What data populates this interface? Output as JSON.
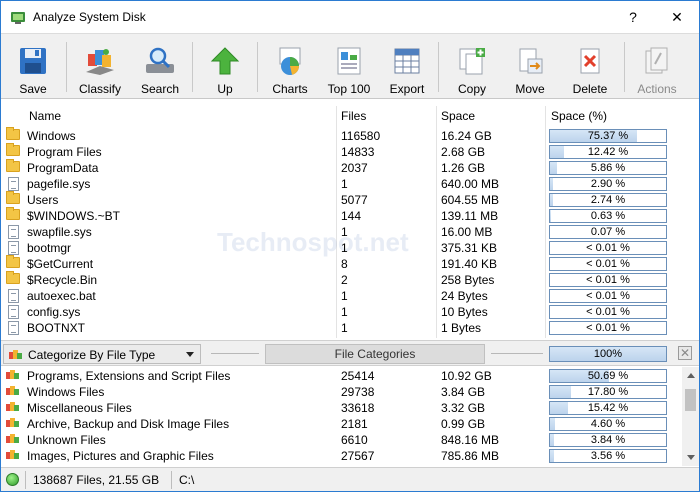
{
  "window": {
    "title": "Analyze System Disk",
    "help_label": "?",
    "close_label": "✕"
  },
  "toolbar": [
    {
      "id": "save",
      "label": "Save",
      "icon": "floppy-disk-icon"
    },
    {
      "id": "classify",
      "label": "Classify",
      "icon": "classify-icon"
    },
    {
      "id": "search",
      "label": "Search",
      "icon": "magnifier-icon"
    },
    {
      "id": "up",
      "label": "Up",
      "icon": "up-arrow-icon"
    },
    {
      "id": "charts",
      "label": "Charts",
      "icon": "pie-chart-icon"
    },
    {
      "id": "top100",
      "label": "Top 100",
      "icon": "top100-icon"
    },
    {
      "id": "export",
      "label": "Export",
      "icon": "export-icon"
    },
    {
      "id": "copy",
      "label": "Copy",
      "icon": "copy-icon"
    },
    {
      "id": "move",
      "label": "Move",
      "icon": "move-icon"
    },
    {
      "id": "delete",
      "label": "Delete",
      "icon": "delete-icon"
    },
    {
      "id": "actions",
      "label": "Actions",
      "icon": "actions-icon",
      "disabled": true
    }
  ],
  "columns": {
    "name": "Name",
    "files": "Files",
    "space": "Space",
    "space_pct": "Space (%)"
  },
  "rows": [
    {
      "name": "Windows",
      "files": "116580",
      "space": "16.24 GB",
      "pct_label": "75.37 %",
      "pct": 75.37,
      "type": "folder"
    },
    {
      "name": "Program Files",
      "files": "14833",
      "space": "2.68 GB",
      "pct_label": "12.42 %",
      "pct": 12.42,
      "type": "folder"
    },
    {
      "name": "ProgramData",
      "files": "2037",
      "space": "1.26 GB",
      "pct_label": "5.86 %",
      "pct": 5.86,
      "type": "folder"
    },
    {
      "name": "pagefile.sys",
      "files": "1",
      "space": "640.00 MB",
      "pct_label": "2.90 %",
      "pct": 2.9,
      "type": "file"
    },
    {
      "name": "Users",
      "files": "5077",
      "space": "604.55 MB",
      "pct_label": "2.74 %",
      "pct": 2.74,
      "type": "folder"
    },
    {
      "name": "$WINDOWS.~BT",
      "files": "144",
      "space": "139.11 MB",
      "pct_label": "0.63 %",
      "pct": 0.63,
      "type": "folder"
    },
    {
      "name": "swapfile.sys",
      "files": "1",
      "space": "16.00 MB",
      "pct_label": "0.07 %",
      "pct": 0.07,
      "type": "file"
    },
    {
      "name": "bootmgr",
      "files": "1",
      "space": "375.31 KB",
      "pct_label": "< 0.01 %",
      "pct": 0,
      "type": "file"
    },
    {
      "name": "$GetCurrent",
      "files": "8",
      "space": "191.40 KB",
      "pct_label": "< 0.01 %",
      "pct": 0,
      "type": "folder"
    },
    {
      "name": "$Recycle.Bin",
      "files": "2",
      "space": "258 Bytes",
      "pct_label": "< 0.01 %",
      "pct": 0,
      "type": "folder"
    },
    {
      "name": "autoexec.bat",
      "files": "1",
      "space": "24 Bytes",
      "pct_label": "< 0.01 %",
      "pct": 0,
      "type": "file"
    },
    {
      "name": "config.sys",
      "files": "1",
      "space": "10 Bytes",
      "pct_label": "< 0.01 %",
      "pct": 0,
      "type": "file"
    },
    {
      "name": "BOOTNXT",
      "files": "1",
      "space": "1 Bytes",
      "pct_label": "< 0.01 %",
      "pct": 0,
      "type": "file"
    }
  ],
  "categorize": {
    "dropdown_value": "Categorize By File Type",
    "button_label": "File Categories",
    "total_pct": "100%"
  },
  "categories": [
    {
      "name": "Programs, Extensions and Script Files",
      "files": "25414",
      "space": "10.92 GB",
      "pct_label": "50.69 %",
      "pct": 50.69
    },
    {
      "name": "Windows Files",
      "files": "29738",
      "space": "3.84 GB",
      "pct_label": "17.80 %",
      "pct": 17.8
    },
    {
      "name": "Miscellaneous Files",
      "files": "33618",
      "space": "3.32 GB",
      "pct_label": "15.42 %",
      "pct": 15.42
    },
    {
      "name": "Archive, Backup and Disk Image Files",
      "files": "2181",
      "space": "0.99 GB",
      "pct_label": "4.60 %",
      "pct": 4.6
    },
    {
      "name": "Unknown Files",
      "files": "6610",
      "space": "848.16 MB",
      "pct_label": "3.84 %",
      "pct": 3.84
    },
    {
      "name": "Images, Pictures and Graphic Files",
      "files": "27567",
      "space": "785.86 MB",
      "pct_label": "3.56 %",
      "pct": 3.56
    }
  ],
  "status": {
    "summary": "138687 Files, 21.55 GB",
    "path": "C:\\"
  },
  "watermark": "Technospot.net"
}
